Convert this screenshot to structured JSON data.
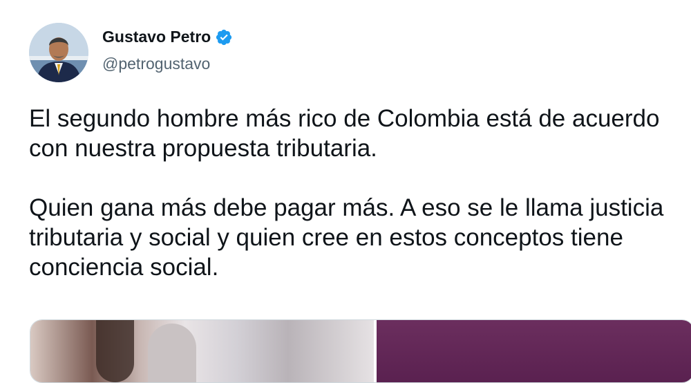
{
  "author": {
    "display_name": "Gustavo Petro",
    "handle": "@petrogustavo",
    "verified_icon": "verified-badge-icon",
    "verified_color": "#1d9bf0"
  },
  "tweet": {
    "paragraphs": [
      "El segundo hombre más rico de Colombia está de acuerdo con nuestra propuesta tributaria.",
      "Quien gana más debe pagar más. A eso se le llama justicia tributaria y social y quien cree en estos conceptos tiene conciencia social."
    ]
  },
  "colors": {
    "text": "#0f1419",
    "secondary_text": "#536471",
    "border": "#cfd9de"
  }
}
